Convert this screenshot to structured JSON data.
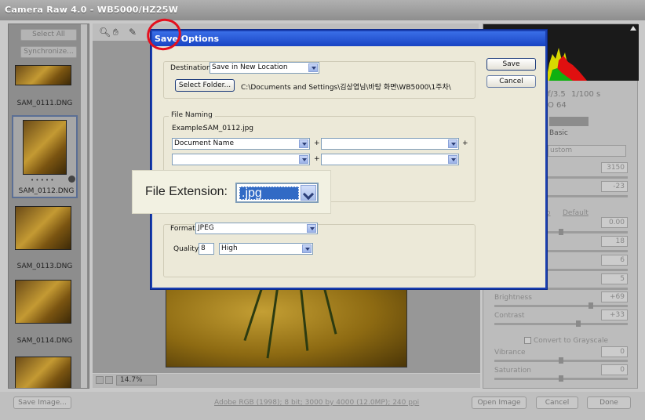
{
  "window": {
    "title": "Camera Raw 4.0  -  WB5000/HZ25W"
  },
  "filmstrip": {
    "select_all": "Select All",
    "synchronize": "Synchronize...",
    "thumbnails": [
      {
        "name": "SAM_0111.DNG"
      },
      {
        "name": "SAM_0112.DNG",
        "rating": "• • • • •"
      },
      {
        "name": "SAM_0113.DNG"
      },
      {
        "name": "SAM_0114.DNG"
      }
    ]
  },
  "preview": {
    "zoom": "14.7%"
  },
  "right_panel": {
    "exif": {
      "aperture": "f/3.5",
      "shutter": "1/100 s",
      "iso": "O 64"
    },
    "tab_basic": "Basic",
    "wb_select": "ustom",
    "default_link": "Default",
    "auto_link": "o",
    "values": [
      "3150",
      "-23",
      "0.00",
      "18",
      "6",
      "5",
      "+69",
      "+33",
      "0",
      "0"
    ],
    "brightness": "Brightness",
    "contrast": "Contrast",
    "grayscale": "Convert to Grayscale",
    "vibrance": "Vibrance",
    "saturation": "Saturation"
  },
  "dialog": {
    "title": "Save Options",
    "save": "Save",
    "cancel": "Cancel",
    "destination_label": "Destination:",
    "destination_value": "Save in New Location",
    "select_folder": "Select Folder...",
    "folder_path": "C:\\Documents and Settings\\김상엽님\\바탕 화면\\WB5000\\1주차\\",
    "file_naming_legend": "File Naming",
    "example_label": "Example:",
    "example_value": "SAM_0112.jpg",
    "naming_first": "Document Name",
    "plus": "+",
    "format_label": "Format:",
    "format_value": "JPEG",
    "quality_label": "Quality:",
    "quality_number": "8",
    "quality_value": "High"
  },
  "callout": {
    "label": "File Extension:",
    "value": ".jpg"
  },
  "bottom": {
    "save_image": "Save Image...",
    "workflow": "Adobe RGB (1998); 8 bit; 3000 by 4000 (12.0MP); 240 ppi",
    "open_image": "Open Image",
    "cancel": "Cancel",
    "done": "Done"
  }
}
